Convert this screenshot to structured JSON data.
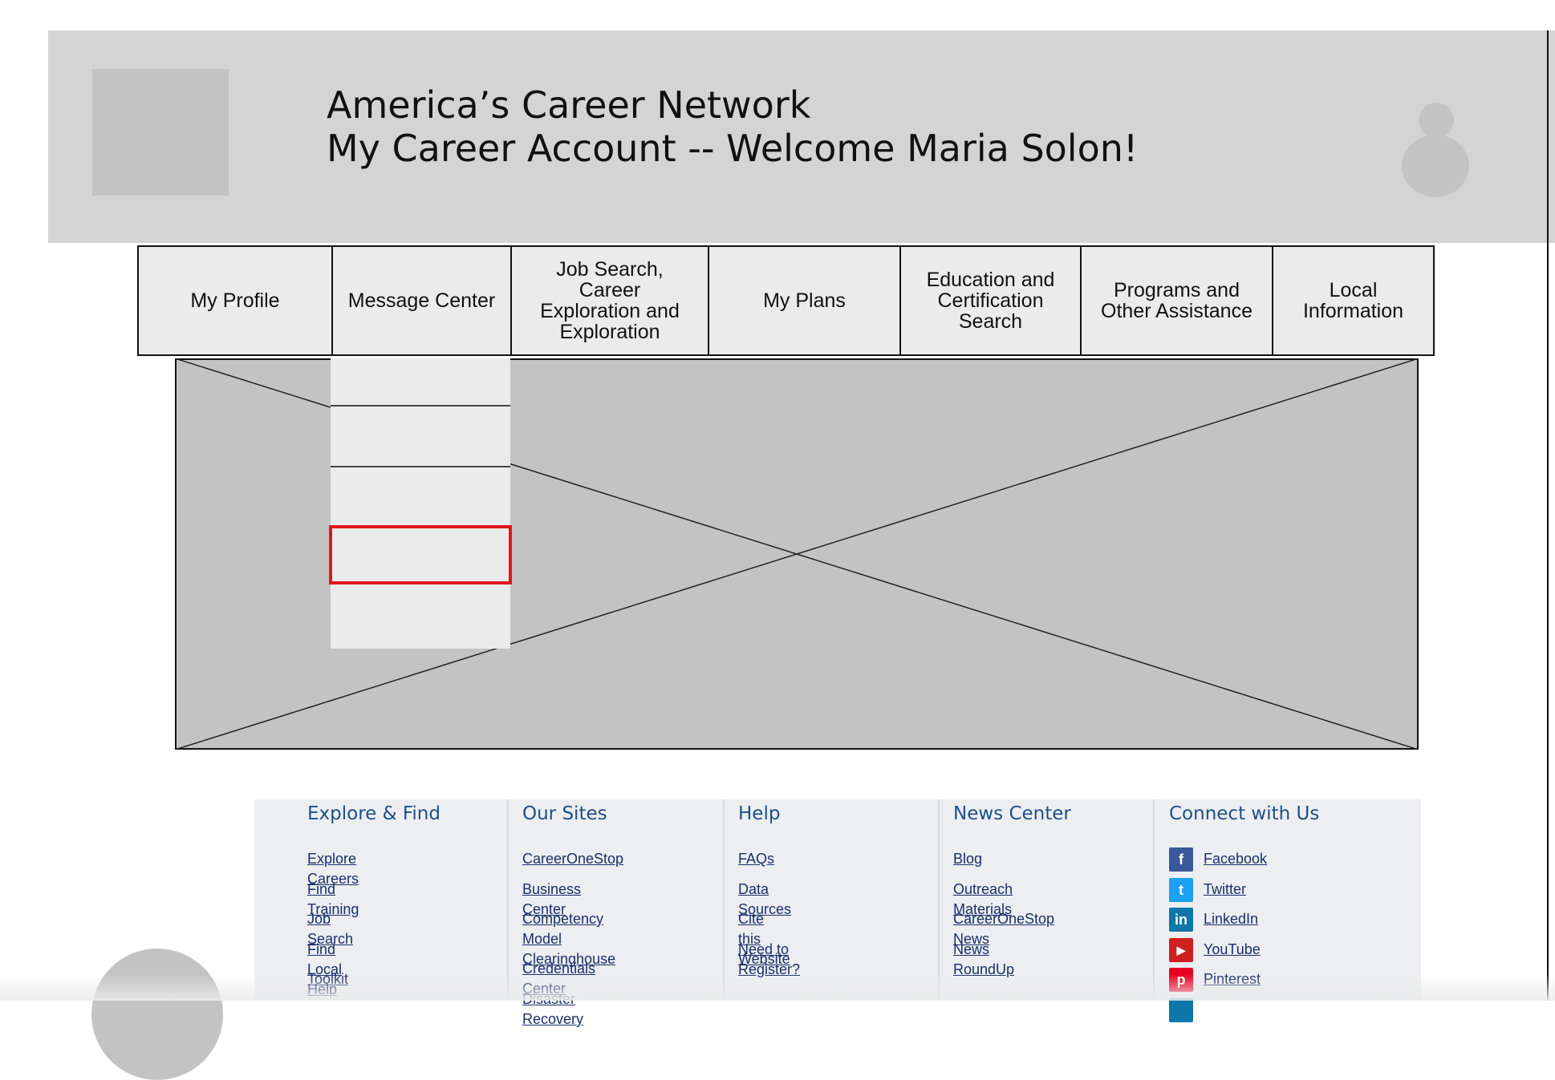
{
  "header": {
    "site_title": "America’s Career Network",
    "account_title": "My Career Account -- Welcome Maria Solon!"
  },
  "nav": {
    "items": [
      {
        "label": "My Profile"
      },
      {
        "label": "Message Center"
      },
      {
        "label": "Job Search,\nCareer\nExploration and\nExploration"
      },
      {
        "label": "My Plans"
      },
      {
        "label": "Education and\nCertification\nSearch"
      },
      {
        "label": "Programs and\nOther Assistance"
      },
      {
        "label": "Local\nInformation"
      }
    ]
  },
  "footer": {
    "columns": [
      {
        "heading": "Explore & Find",
        "links": [
          "Explore Careers",
          "Find Training",
          "Job Search",
          "Find Local Help",
          "Toolkit"
        ]
      },
      {
        "heading": "Our Sites",
        "links": [
          "CareerOneStop",
          "Business Center",
          "Competency Model\nClearinghouse",
          "Credentials Center",
          "Disaster Recovery"
        ]
      },
      {
        "heading": "Help",
        "links": [
          "FAQs",
          "Data Sources",
          "Cite this Website",
          "Need to Register?"
        ]
      },
      {
        "heading": "News Center",
        "links": [
          "Blog",
          "Outreach Materials",
          "CareerOneStop News",
          "News RoundUp"
        ]
      },
      {
        "heading": "Connect with Us",
        "links": [
          {
            "label": "Facebook",
            "icon": "facebook-icon",
            "glyph": "f",
            "color": "#3b5998"
          },
          {
            "label": "Twitter",
            "icon": "twitter-icon",
            "glyph": "t",
            "color": "#1da1f2"
          },
          {
            "label": "LinkedIn",
            "icon": "linkedin-icon",
            "glyph": "in",
            "color": "#0e76a8"
          },
          {
            "label": "YouTube",
            "icon": "youtube-icon",
            "glyph": "▶",
            "color": "#cd201f"
          },
          {
            "label": "Pinterest",
            "icon": "pinterest-icon",
            "glyph": "p",
            "color": "#e60023"
          }
        ]
      }
    ]
  },
  "colors": {
    "header_bg": "#d4d4d4",
    "placeholder": "#c3c3c3",
    "nav_bg": "#ebebeb",
    "highlight": "#e2161d",
    "footer_bg": "#eceef1",
    "footer_heading": "#1f4f87"
  }
}
